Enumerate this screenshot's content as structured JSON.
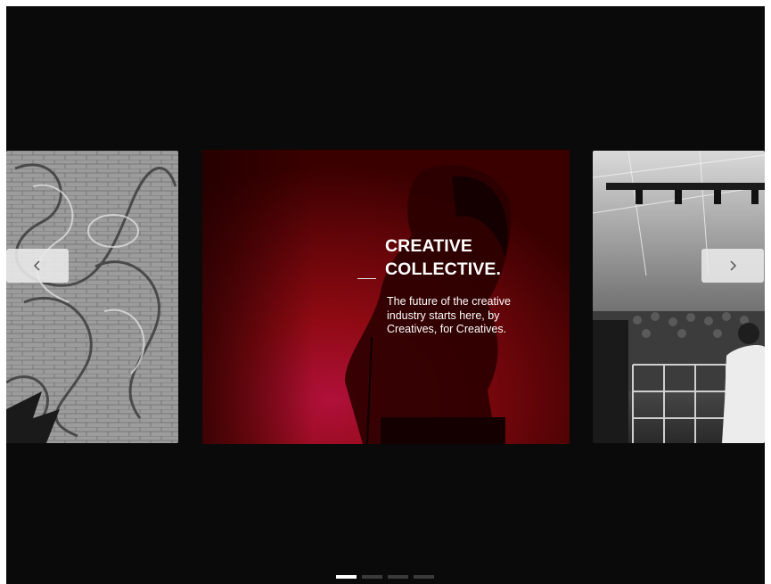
{
  "hero": {
    "title_line1": "CREATIVE",
    "title_line2": "COLLECTIVE.",
    "description": "The future of the creative industry starts here, by Creatives, for Creatives."
  },
  "slides": [
    {
      "subject": "graffiti-wall",
      "tone": "grayscale"
    },
    {
      "subject": "singer-with-microphone",
      "tone": "red",
      "accent": "#8b0000"
    },
    {
      "subject": "concert-crowd-stage",
      "tone": "grayscale"
    }
  ],
  "navigation": {
    "prev_icon": "chevron-left-icon",
    "next_icon": "chevron-right-icon"
  },
  "pagination": {
    "count": 4,
    "active_index": 0
  },
  "colors": {
    "background": "#0a0a0a",
    "active_dot": "#ffffff",
    "inactive_dot": "#3a3a3a"
  }
}
